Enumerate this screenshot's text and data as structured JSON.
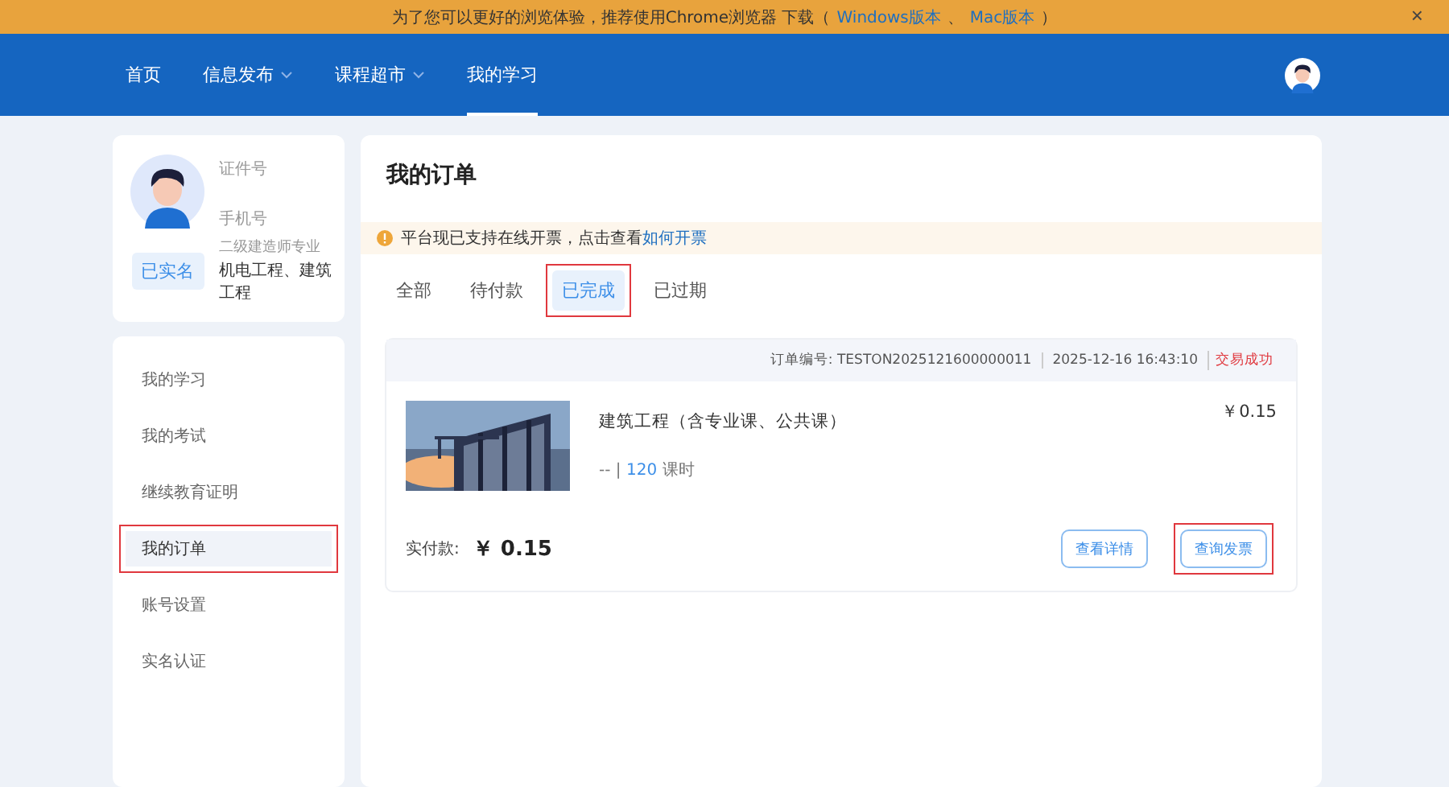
{
  "banner": {
    "text": "为了您可以更好的浏览体验，推荐使用Chrome浏览器 下载（",
    "links": [
      "Windows版本",
      "Mac版本"
    ],
    "separator": "、",
    "end": "）",
    "close": "×"
  },
  "nav": {
    "items": [
      {
        "label": "首页",
        "dropdown": false,
        "selected": false
      },
      {
        "label": "信息发布",
        "dropdown": true,
        "selected": false
      },
      {
        "label": "课程超市",
        "dropdown": true,
        "selected": false
      },
      {
        "label": "我的学习",
        "dropdown": false,
        "selected": true
      }
    ]
  },
  "profile": {
    "id_label": "证件号",
    "phone_label": "手机号",
    "verified": "已实名",
    "major_label": "二级建造师专业",
    "major": "机电工程、建筑工程"
  },
  "sidebar": {
    "items": [
      {
        "label": "我的学习",
        "selected": false,
        "outlined": false
      },
      {
        "label": "我的考试",
        "selected": false,
        "outlined": false
      },
      {
        "label": "继续教育证明",
        "selected": false,
        "outlined": false
      },
      {
        "label": "我的订单",
        "selected": true,
        "outlined": true
      },
      {
        "label": "账号设置",
        "selected": false,
        "outlined": false
      },
      {
        "label": "实名认证",
        "selected": false,
        "outlined": false
      }
    ]
  },
  "main": {
    "title": "我的订单",
    "notice": {
      "text": "平台现已支持在线开票，点击查看",
      "link": "如何开票"
    },
    "tabs": [
      {
        "label": "全部",
        "selected": false,
        "outlined": false
      },
      {
        "label": "待付款",
        "selected": false,
        "outlined": false
      },
      {
        "label": "已完成",
        "selected": true,
        "outlined": true
      },
      {
        "label": "已过期",
        "selected": false,
        "outlined": false
      }
    ],
    "order": {
      "number_label": "订单编号:",
      "number": "TESTON2025121600000011",
      "time": "2025-12-16 16:43:10",
      "status": "交易成功",
      "course": {
        "kind": "picture",
        "name": "建筑工程（含专业课、公共课）",
        "meta": "--",
        "meta_separator": "|",
        "hours": "120",
        "hours_unit": "课时",
        "price": "￥0.15"
      },
      "paid_label": "实付款:",
      "paid": "￥ 0.15",
      "buttons": [
        {
          "label": "查看详情",
          "outlined": false
        },
        {
          "label": "查询发票",
          "outlined": true
        }
      ]
    }
  }
}
